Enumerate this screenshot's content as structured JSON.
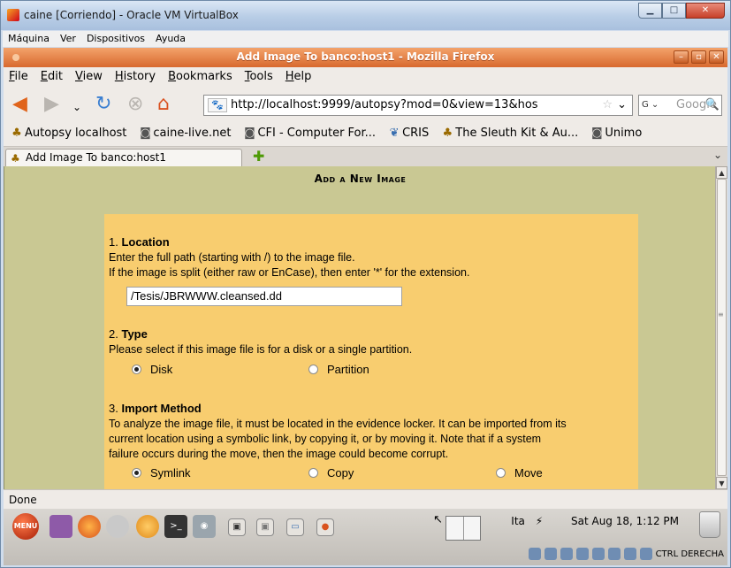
{
  "vbox": {
    "title": "caine [Corriendo] - Oracle VM VirtualBox",
    "menu": [
      "Máquina",
      "Ver",
      "Dispositivos",
      "Ayuda"
    ]
  },
  "firefox": {
    "title": "Add Image To banco:host1 - Mozilla Firefox",
    "menu": [
      "File",
      "Edit",
      "View",
      "History",
      "Bookmarks",
      "Tools",
      "Help"
    ],
    "url": "http://localhost:9999/autopsy?mod=0&view=13&hos",
    "search_placeholder": "Google",
    "bookmarks": [
      {
        "label": "Autopsy localhost",
        "icon": "autopsy-icon"
      },
      {
        "label": "caine-live.net",
        "icon": "page-icon"
      },
      {
        "label": "CFI - Computer For...",
        "icon": "page-icon"
      },
      {
        "label": "CRIS",
        "icon": "cris-icon"
      },
      {
        "label": "The Sleuth Kit & Au...",
        "icon": "autopsy-icon"
      },
      {
        "label": "Unimo",
        "icon": "page-icon"
      }
    ],
    "tab_label": "Add Image To banco:host1",
    "status": "Done"
  },
  "page": {
    "heading": "Add a New Image",
    "location": {
      "number": "1.",
      "title": "Location",
      "line1": "Enter the full path (starting with /) to the image file.",
      "line2": "If the image is split (either raw or EnCase), then enter '*' for the extension.",
      "value": "/Tesis/JBRWWW.cleansed.dd"
    },
    "type": {
      "number": "2.",
      "title": "Type",
      "line1": "Please select if this image file is for a disk or a single partition.",
      "options": [
        {
          "label": "Disk",
          "selected": true
        },
        {
          "label": "Partition",
          "selected": false
        }
      ]
    },
    "import": {
      "number": "3.",
      "title": "Import Method",
      "line1": "To analyze the image file, it must be located in the evidence locker. It can be imported from its",
      "line2": "current location using a symbolic link, by copying it, or by moving it. Note that if a system",
      "line3": "failure occurs during the move, then the image could become corrupt.",
      "options": [
        {
          "label": "Symlink",
          "selected": true
        },
        {
          "label": "Copy",
          "selected": false
        },
        {
          "label": "Move",
          "selected": false
        }
      ]
    }
  },
  "taskbar": {
    "menu_label": "MENU",
    "keyboard_layout": "Ita",
    "clock": "Sat Aug 18,  1:12 PM",
    "host_key": "CTRL DERECHA"
  },
  "colors": {
    "firefox_titlebar": "#d8692e",
    "page_background": "#c9c893",
    "form_panel": "#f8cd6f"
  }
}
